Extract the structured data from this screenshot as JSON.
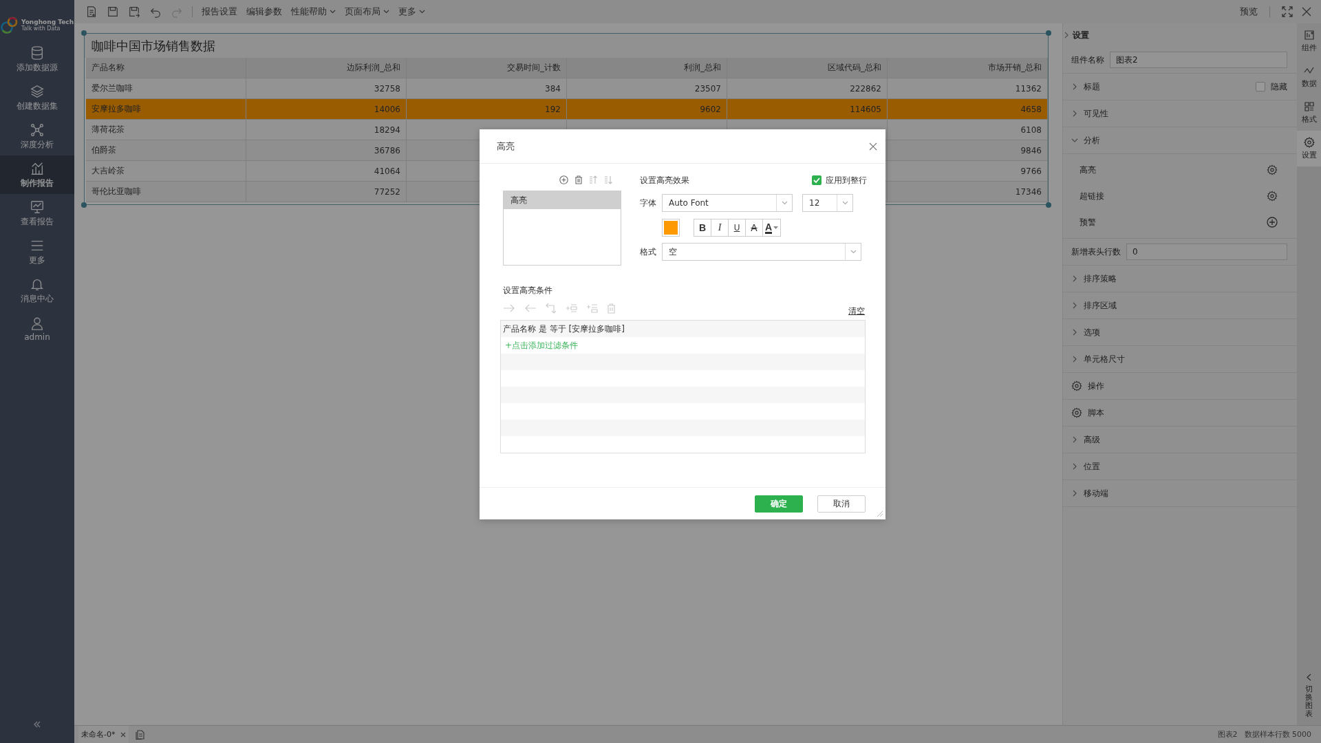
{
  "sidebar": {
    "logo": {
      "name": "Yonghong Tech",
      "tagline": "Talk with Data"
    },
    "items": [
      {
        "label": "添加数据源",
        "kind": "database",
        "selected": false
      },
      {
        "label": "创建数据集",
        "kind": "layers",
        "selected": false
      },
      {
        "label": "深度分析",
        "kind": "network",
        "selected": false
      },
      {
        "label": "制作报告",
        "kind": "chart",
        "selected": true
      },
      {
        "label": "查看报告",
        "kind": "monitor",
        "selected": false
      },
      {
        "label": "更多",
        "kind": "menu",
        "selected": false
      },
      {
        "label": "消息中心",
        "kind": "bell",
        "selected": false
      },
      {
        "label": "admin",
        "kind": "user",
        "selected": false
      }
    ]
  },
  "toolbar": {
    "icons": [
      {
        "kind": "new",
        "disabled": false
      },
      {
        "kind": "save",
        "disabled": false
      },
      {
        "kind": "save-as",
        "disabled": false
      },
      {
        "kind": "undo",
        "disabled": false
      },
      {
        "kind": "redo",
        "disabled": true
      }
    ],
    "menus": [
      {
        "label": "报告设置",
        "dropdown": false
      },
      {
        "label": "编辑参数",
        "dropdown": false
      },
      {
        "label": "性能帮助",
        "dropdown": true
      },
      {
        "label": "页面布局",
        "dropdown": true
      },
      {
        "label": "更多",
        "dropdown": true
      }
    ],
    "preview": "预览"
  },
  "report": {
    "title": "咖啡中国市场销售数据",
    "table": {
      "columns": [
        "产品名称",
        "边际利润_总和",
        "交易时间_计数",
        "利润_总和",
        "区域代码_总和",
        "市场开销_总和"
      ],
      "rows": [
        {
          "cells": [
            "爱尔兰咖啡",
            "32758",
            "384",
            "23507",
            "222862",
            "11362"
          ],
          "highlighted": false
        },
        {
          "cells": [
            "安摩拉多咖啡",
            "14006",
            "192",
            "9602",
            "114605",
            "4658"
          ],
          "highlighted": true
        },
        {
          "cells": [
            "薄荷花茶",
            "18294",
            null,
            null,
            null,
            "6108"
          ],
          "highlighted": false
        },
        {
          "cells": [
            "伯爵茶",
            "36786",
            null,
            null,
            null,
            "9846"
          ],
          "highlighted": false
        },
        {
          "cells": [
            "大吉岭茶",
            "41064",
            null,
            null,
            null,
            "9766"
          ],
          "highlighted": false
        },
        {
          "cells": [
            "哥伦比亚咖啡",
            "77252",
            null,
            null,
            null,
            "17346"
          ],
          "highlighted": false
        }
      ]
    }
  },
  "settings": {
    "title": "设置",
    "name_label": "组件名称",
    "name_value": "图表2",
    "sections": [
      {
        "kind": "section",
        "label": "标题",
        "expanded": false,
        "hide": {
          "label": "隐藏",
          "checked": false
        }
      },
      {
        "kind": "section",
        "label": "可见性",
        "expanded": false
      },
      {
        "kind": "section",
        "label": "分析",
        "expanded": true,
        "children": [
          {
            "label": "高亮",
            "kind": "gear"
          },
          {
            "label": "超链接",
            "kind": "gear"
          },
          {
            "label": "预警",
            "kind": "add"
          }
        ]
      },
      {
        "kind": "input",
        "label": "新增表头行数",
        "value": "0"
      },
      {
        "kind": "section",
        "label": "排序策略",
        "expanded": false
      },
      {
        "kind": "section",
        "label": "排序区域",
        "expanded": false
      },
      {
        "kind": "section",
        "label": "选项",
        "expanded": false
      },
      {
        "kind": "section",
        "label": "单元格尺寸",
        "expanded": false
      },
      {
        "kind": "action",
        "label": "操作"
      },
      {
        "kind": "action",
        "label": "脚本"
      },
      {
        "kind": "section",
        "label": "高级",
        "expanded": false
      },
      {
        "kind": "section",
        "label": "位置",
        "expanded": false
      },
      {
        "kind": "section",
        "label": "移动端",
        "expanded": false
      }
    ]
  },
  "side_tabs": [
    {
      "label": "组件",
      "kind": "component",
      "selected": false
    },
    {
      "label": "数据",
      "kind": "data",
      "selected": false
    },
    {
      "label": "格式",
      "kind": "format",
      "selected": false
    },
    {
      "label": "设置",
      "kind": "settings",
      "selected": true
    }
  ],
  "switch_chart": "切换图表",
  "status_bar": {
    "tab": "未命名-0*",
    "chart": "图表2",
    "sample_rows": "数据样本行数 5000"
  },
  "dialog": {
    "title": "高亮",
    "rules": [
      {
        "label": "高亮",
        "selected": true
      }
    ],
    "effect_title": "设置高亮效果",
    "apply_row": {
      "label": "应用到整行",
      "checked": true
    },
    "font_label": "字体",
    "font": "Auto Font",
    "size": "12",
    "color": "#ff9900",
    "styles": [
      {
        "kind": "bold",
        "glyph": "B"
      },
      {
        "kind": "italic",
        "glyph": "I"
      },
      {
        "kind": "underline",
        "glyph": "U"
      },
      {
        "kind": "strike",
        "glyph": "A"
      },
      {
        "kind": "color",
        "glyph": "A"
      }
    ],
    "format_label": "格式",
    "format": "空",
    "condition_title": "设置高亮条件",
    "clear": "清空",
    "conditions": [
      "产品名称 是 等于 [安摩拉多咖啡]"
    ],
    "add_condition": "+点击添加过滤条件",
    "ok": "确定",
    "cancel": "取消"
  }
}
